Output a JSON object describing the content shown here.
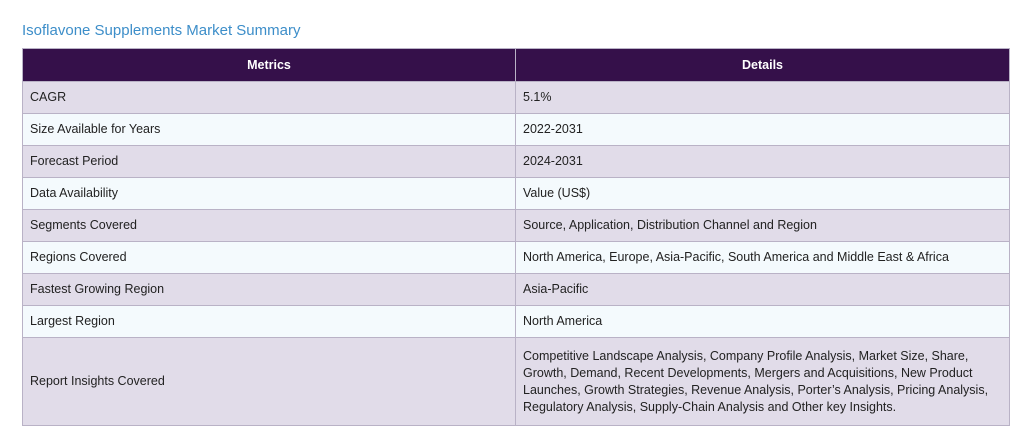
{
  "page": {
    "title": "Isoflavone Supplements Market Summary"
  },
  "table": {
    "headers": [
      "Metrics",
      "Details"
    ],
    "rows": [
      {
        "metric": "CAGR",
        "detail": "5.1%"
      },
      {
        "metric": "Size Available for Years",
        "detail": "2022-2031"
      },
      {
        "metric": "Forecast Period",
        "detail": "2024-2031"
      },
      {
        "metric": "Data Availability",
        "detail": "Value (US$)"
      },
      {
        "metric": "Segments Covered",
        "detail": "Source, Application, Distribution Channel and Region"
      },
      {
        "metric": "Regions Covered",
        "detail": "North America, Europe, Asia-Pacific, South America and Middle East & Africa"
      },
      {
        "metric": "Fastest Growing Region",
        "detail": "Asia-Pacific"
      },
      {
        "metric": "Largest Region",
        "detail": "North America"
      },
      {
        "metric": "Report Insights Covered",
        "detail": "Competitive Landscape Analysis, Company Profile Analysis, Market Size, Share, Growth, Demand, Recent Developments, Mergers and Acquisitions, New Product Launches, Growth Strategies, Revenue Analysis, Porter’s Analysis, Pricing Analysis, Regulatory Analysis, Supply-Chain Analysis and Other key Insights."
      }
    ]
  },
  "colors": {
    "title": "#3d8ec9",
    "header_bg": "#35104a",
    "header_text": "#ffffff",
    "row_odd_bg": "#e1dce9",
    "row_even_bg": "#f4fafd",
    "border": "#b9b2c6"
  }
}
